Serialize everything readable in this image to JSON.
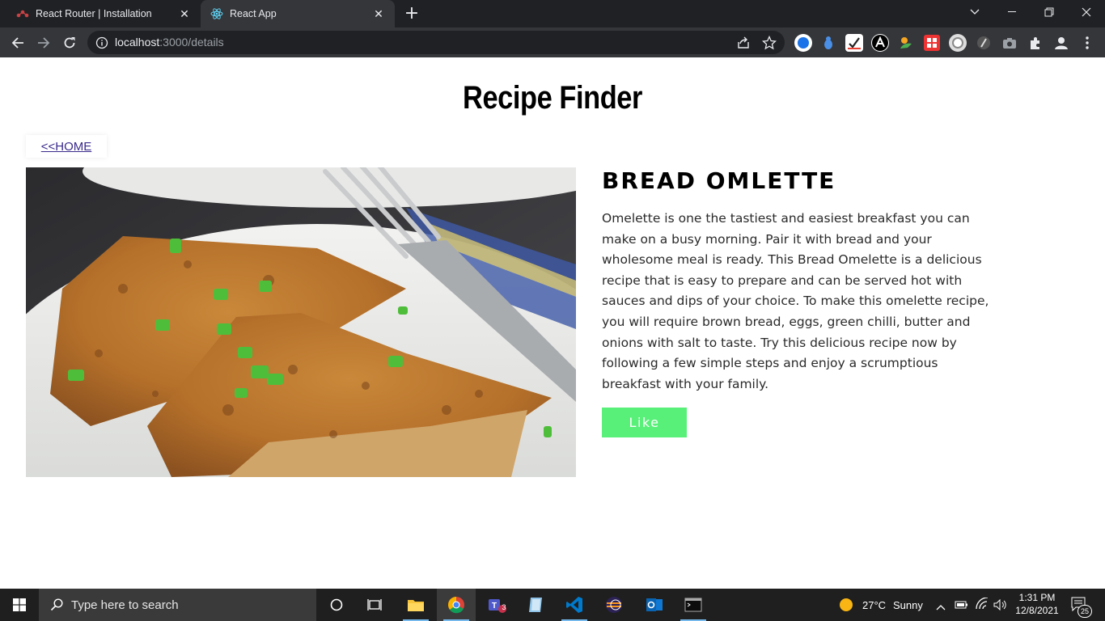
{
  "browser": {
    "tabs": [
      {
        "title": "React Router | Installation",
        "active": false,
        "icon": "react-router-icon"
      },
      {
        "title": "React App",
        "active": true,
        "icon": "react-icon"
      }
    ],
    "url_host": "localhost",
    "url_path": ":3000/details",
    "new_tab": "+",
    "extensions": [
      "edge-ext-icon",
      "bug-ext-icon",
      "check-ext-icon",
      "angular-ext-icon",
      "leaf-ext-icon",
      "grid-ext-icon",
      "circle-ext-icon",
      "slash-ext-icon",
      "camera-ext-icon",
      "puzzle-icon",
      "profile-icon",
      "menu-icon"
    ]
  },
  "page": {
    "title": "Recipe Finder",
    "home_link": "<<HOME",
    "recipe_name": "BREAD OMLETTE",
    "description": "Omelette is one the tastiest and easiest breakfast you can make on a busy morning. Pair it with bread and your wholesome meal is ready. This Bread Omelette is a delicious recipe that is easy to prepare and can be served hot with sauces and dips of your choice. To make this omelette recipe, you will require brown bread, eggs, green chilli, butter and onions with salt to taste. Try this delicious recipe now by following a few simple steps and enjoy a scrumptious breakfast with your family.",
    "like_label": "Like",
    "like_color": "#59f07a"
  },
  "taskbar": {
    "search_placeholder": "Type here to search",
    "teams_badge": "3",
    "weather_temp": "27°C",
    "weather_text": "Sunny",
    "time": "1:31 PM",
    "date": "12/8/2021",
    "notifications": "25"
  }
}
